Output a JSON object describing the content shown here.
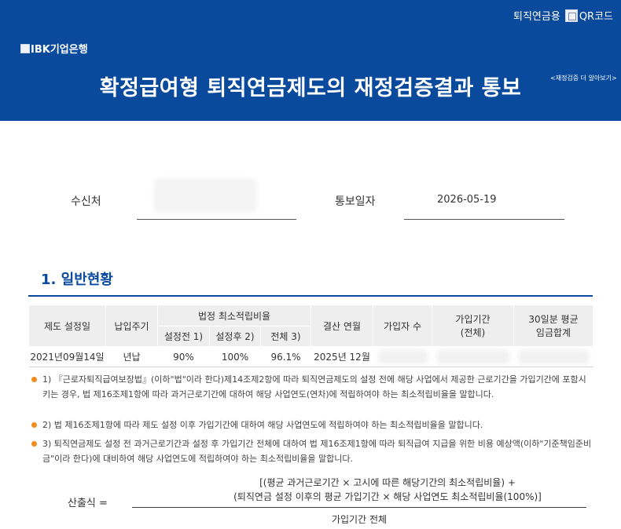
{
  "header": {
    "qr_label": "퇴직연금용",
    "qr_link": "QR코드",
    "logo_text": "IBK기업은행",
    "title": "확정급여형 퇴직연금제도의 재정검증결과 통보",
    "more_link": "<재정검증 더 알아보기>"
  },
  "recipient": {
    "label": "수신처",
    "value": ""
  },
  "notice_date": {
    "label": "통보일자",
    "value": "2026-05-19"
  },
  "section1": {
    "title": "1. 일반현황"
  },
  "table": {
    "headers": {
      "establish_date": "제도 설정일",
      "payment_cycle": "납입주기",
      "min_ratio_group": "법정 최소적립비율",
      "before": "설정전 1)",
      "after": "설정후 2)",
      "total": "전체 3)",
      "settlement": "결산 연월",
      "members": "가입자 수",
      "period_line1": "가입기간",
      "period_line2": "(전체)",
      "wage_line1": "30일분 평균",
      "wage_line2": "임금합계"
    },
    "row": {
      "establish_date": "2021년09월14일",
      "payment_cycle": "년납",
      "before": "90%",
      "after": "100%",
      "total": "96.1%",
      "settlement": "2025년 12월"
    }
  },
  "notes": [
    "1) 『근로자퇴직급여보장법』(이하\"법\"이라 한다)제14조제2항에 따라 퇴직연금제도의 설정 전에 해당 사업에서 제공한 근로기간을 가입기간에 포함시키는 경우, 법 제16조제1항에 따라 과거근로기간에 대하여 해당 사업연도(연차)에 적립하여야 하는 최소적립비율을 말합니다.",
    "2) 법 제16조제1항에 따라 제도 설정 이후 가입기간에 대하여 해당 사업연도에 적립하여야 하는 최소적립비율을 말합니다.",
    "3) 퇴직연금제도 설정 전 과거근로기간과 설정 후 가입기간 전체에 대하여 법 제16조제1항에 따라 퇴직급여 지급을 위한 비용 예상액(이하\"기준책임준비금\"이라 한다)에 대비하여 해당 사업연도에 적립하여야 하는 최소적립비율을 말합니다."
  ],
  "formula": {
    "label": "산출식 =",
    "numerator_line1": "[(평균 과거근로기간 × 고시에 따른 해당기간의 최소적립비율) +",
    "numerator_line2": "(퇴직연금 설정 이후의 평균 가입기간 × 해당 사업연도 최소적립비율(100%)]",
    "denominator": "가입기간 전체"
  },
  "colors": {
    "brand": "#0a4a9c",
    "bullet": "#f08c1e"
  }
}
